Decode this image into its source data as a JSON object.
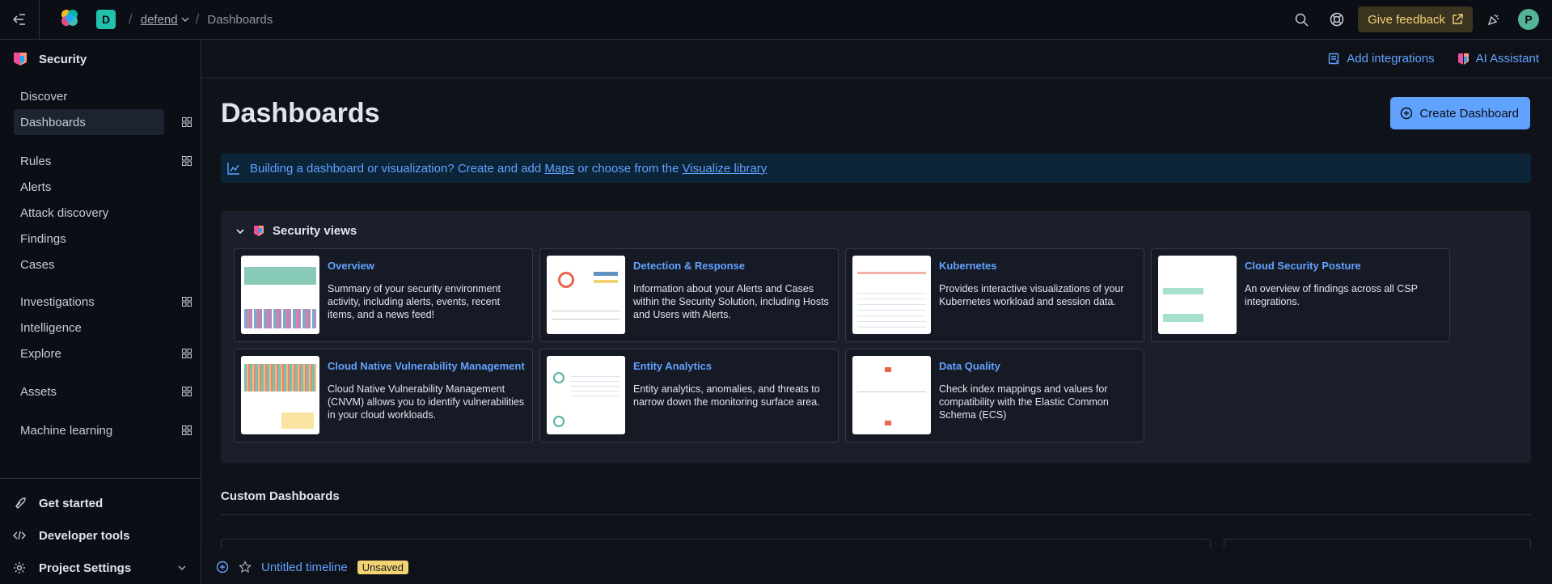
{
  "header": {
    "space_initial": "D",
    "project": "defend",
    "current": "Dashboards",
    "feedback_label": "Give feedback",
    "user_initial": "P",
    "colors": {
      "space": "#22c1ab",
      "feedback_bg": "#3b3421",
      "feedback_fg": "#f3d371",
      "avatar": "#54b399"
    }
  },
  "sidebar": {
    "title": "Security",
    "items": [
      {
        "label": "Discover"
      },
      {
        "label": "Dashboards"
      },
      {
        "label": "Rules"
      },
      {
        "label": "Alerts"
      },
      {
        "label": "Attack discovery"
      },
      {
        "label": "Findings"
      },
      {
        "label": "Cases"
      },
      {
        "label": "Investigations"
      },
      {
        "label": "Intelligence"
      },
      {
        "label": "Explore"
      },
      {
        "label": "Assets"
      },
      {
        "label": "Machine learning"
      }
    ],
    "bottom": [
      {
        "label": "Get started"
      },
      {
        "label": "Developer tools"
      },
      {
        "label": "Project Settings"
      }
    ]
  },
  "subheader": {
    "add_integrations": "Add integrations",
    "ai_assistant": "AI Assistant"
  },
  "page": {
    "title": "Dashboards",
    "create_button": "Create Dashboard",
    "callout_prefix": "Building a dashboard or visualization? Create and add ",
    "callout_maps": "Maps",
    "callout_middle": " or choose from the ",
    "callout_library": "Visualize library"
  },
  "security_views": {
    "heading": "Security views",
    "cards": [
      {
        "title": "Overview",
        "desc": "Summary of your security environment activity, including alerts, events, recent items, and a news feed!"
      },
      {
        "title": "Detection & Response",
        "desc": "Information about your Alerts and Cases within the Security Solution, including Hosts and Users with Alerts."
      },
      {
        "title": "Kubernetes",
        "desc": "Provides interactive visualizations of your Kubernetes workload and session data."
      },
      {
        "title": "Cloud Security Posture",
        "desc": "An overview of findings across all CSP integrations."
      },
      {
        "title": "Cloud Native Vulnerability Management",
        "desc": "Cloud Native Vulnerability Management (CNVM) allows you to identify vulnerabilities in your cloud workloads."
      },
      {
        "title": "Entity Analytics",
        "desc": "Entity analytics, anomalies, and threats to narrow down the monitoring surface area."
      },
      {
        "title": "Data Quality",
        "desc": "Check index mappings and values for compatibility with the Elastic Common Schema (ECS)"
      }
    ]
  },
  "custom": {
    "title": "Custom Dashboards"
  },
  "timeline": {
    "title": "Untitled timeline",
    "badge": "Unsaved"
  }
}
